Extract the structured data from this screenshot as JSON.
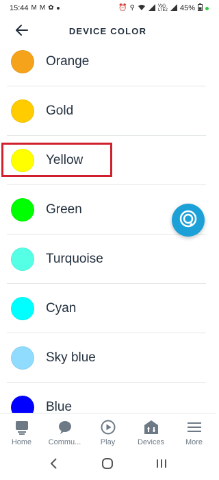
{
  "status_bar": {
    "time": "15:44",
    "battery": "45%",
    "left_icons": [
      "gmail-icon",
      "gmail-icon",
      "settings-icon"
    ],
    "right_icons": [
      "alarm-icon",
      "location-icon",
      "wifi-icon",
      "volte-signal-icon",
      "signal-icon",
      "battery-icon"
    ],
    "network_label": "Vo))\nLTE2"
  },
  "header": {
    "title": "DEVICE COLOR",
    "back_icon": "arrow-left-icon"
  },
  "colors": [
    {
      "name": "Orange",
      "hex": "#f5a31a"
    },
    {
      "name": "Gold",
      "hex": "#ffcc00"
    },
    {
      "name": "Yellow",
      "hex": "#ffff00"
    },
    {
      "name": "Green",
      "hex": "#00ff00"
    },
    {
      "name": "Turquoise",
      "hex": "#55ffe6"
    },
    {
      "name": "Cyan",
      "hex": "#00ffff"
    },
    {
      "name": "Sky blue",
      "hex": "#90dcff"
    },
    {
      "name": "Blue",
      "hex": "#0000ff"
    }
  ],
  "highlight": {
    "item": "Yellow",
    "color": "#d0202e"
  },
  "alexa_button": {
    "icon": "alexa-icon",
    "color": "#1ba0d7"
  },
  "bottom_nav": [
    {
      "label": "Home",
      "icon": "home-icon"
    },
    {
      "label": "Commu...",
      "icon": "chat-bubble-icon"
    },
    {
      "label": "Play",
      "icon": "play-icon"
    },
    {
      "label": "Devices",
      "icon": "devices-icon"
    },
    {
      "label": "More",
      "icon": "menu-icon"
    }
  ],
  "system_nav": [
    "back-chevron-icon",
    "home-circle-icon",
    "recents-icon"
  ]
}
